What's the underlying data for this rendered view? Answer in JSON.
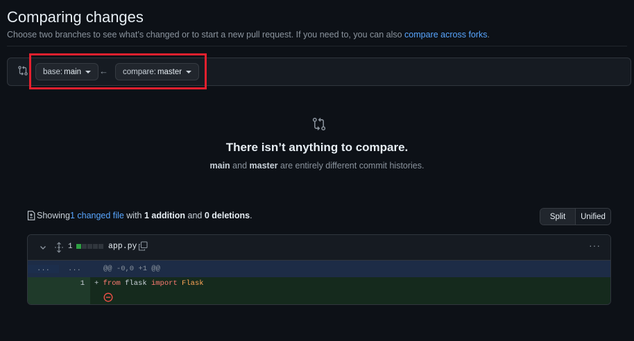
{
  "header": {
    "title": "Comparing changes",
    "subtitle_text": "Choose two branches to see what’s changed or to start a new pull request. If you need to, you can also ",
    "subtitle_link": "compare across forks",
    "subtitle_end": "."
  },
  "range": {
    "icon": "git-compare-icon",
    "base_key": "base: ",
    "base_value": "main",
    "arrow": "←",
    "compare_key": "compare: ",
    "compare_value": "master"
  },
  "blankslate": {
    "icon": "git-compare-icon",
    "title": "There isn’t anything to compare.",
    "desc_branch1": "main",
    "desc_and": " and ",
    "desc_branch2": "master",
    "desc_rest": " are entirely different commit histories."
  },
  "toc": {
    "icon": "file-diff-icon",
    "showing": "Showing ",
    "changed_link": "1 changed file",
    "with": " with ",
    "additions": "1 addition",
    "and": " and ",
    "deletions": "0 deletions",
    "end": "."
  },
  "view_toggle": {
    "split_label": "Split",
    "unified_label": "Unified",
    "selected": "Split"
  },
  "file": {
    "name": "app.py",
    "changes_count": "1",
    "diffstat_colors": [
      "#2ea043",
      "#30363d",
      "#30363d",
      "#30363d",
      "#30363d"
    ],
    "menu": "···",
    "hunk": {
      "left_ln": "...",
      "right_ln": "...",
      "header": "@@ -0,0 +1 @@"
    },
    "lines": [
      {
        "new_ln": "1",
        "marker": "+ ",
        "tokens": [
          {
            "text": "from",
            "type": "keyword"
          },
          {
            "text": " flask ",
            "type": "plain"
          },
          {
            "text": "import",
            "type": "keyword"
          },
          {
            "text": " Flask",
            "type": "class"
          }
        ]
      }
    ]
  },
  "colors": {
    "background": "#0d1117",
    "link": "#58a6ff",
    "highlight": "#e5202e",
    "addition_bg": "#152a1d",
    "hunk_bg": "#1d2c46"
  }
}
